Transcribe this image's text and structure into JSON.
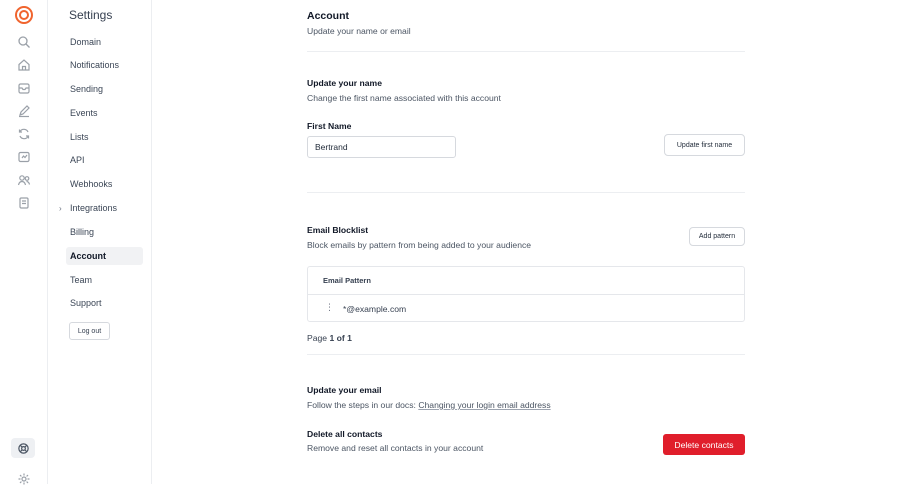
{
  "rail": {
    "icons": [
      "search-icon",
      "home-icon",
      "inbox-icon",
      "compose-icon",
      "workflow-icon",
      "dashboard-icon",
      "users-icon",
      "database-icon"
    ],
    "bottom_icons": [
      "help-icon",
      "settings-icon"
    ]
  },
  "sidebar": {
    "title": "Settings",
    "items": [
      {
        "label": "Domain"
      },
      {
        "label": "Notifications"
      },
      {
        "label": "Sending"
      },
      {
        "label": "Events"
      },
      {
        "label": "Lists"
      },
      {
        "label": "API"
      },
      {
        "label": "Webhooks"
      },
      {
        "label": "Integrations"
      },
      {
        "label": "Billing"
      },
      {
        "label": "Account"
      },
      {
        "label": "Team"
      },
      {
        "label": "Support"
      }
    ],
    "active": "Account",
    "logout_label": "Log out"
  },
  "account": {
    "title": "Account",
    "subtitle": "Update your name or email"
  },
  "name_section": {
    "title": "Update your name",
    "subtitle": "Change the first name associated with this account",
    "field_label": "First Name",
    "field_value": "Bertrand",
    "button_label": "Update first name"
  },
  "blocklist": {
    "title": "Email Blocklist",
    "subtitle": "Block emails by pattern from being added to your audience",
    "button_label": "Add pattern",
    "column_header": "Email Pattern",
    "rows": [
      {
        "pattern": "*@example.com"
      }
    ],
    "pagination": {
      "page_word": "Page",
      "current": "1",
      "of_word": "of",
      "total": "1"
    }
  },
  "email_section": {
    "title": "Update your email",
    "subtitle_prefix": "Follow the steps in our docs:",
    "docs_link": "Changing your login email address"
  },
  "delete_section": {
    "title": "Delete all contacts",
    "subtitle": "Remove and reset all contacts in your account",
    "button_label": "Delete contacts",
    "button_color": "#e01e2b"
  },
  "colors": {
    "brand": "#f0642e"
  }
}
